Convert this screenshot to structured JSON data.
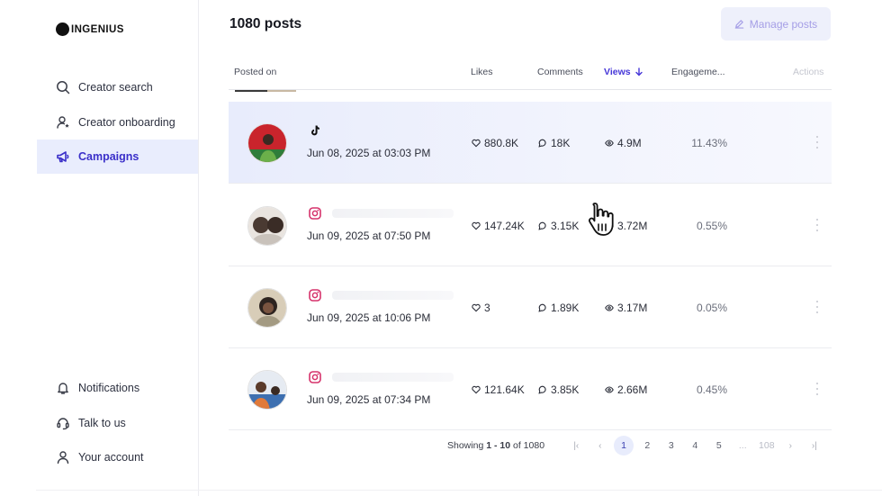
{
  "app": {
    "logo": "INGENIUS"
  },
  "sidebar": {
    "top_items": [
      {
        "label": "Creator search",
        "icon": "search-icon",
        "active": false
      },
      {
        "label": "Creator onboarding",
        "icon": "user-star-icon",
        "active": false
      },
      {
        "label": "Campaigns",
        "icon": "megaphone-icon",
        "active": true
      }
    ],
    "bottom_items": [
      {
        "label": "Notifications",
        "icon": "bell-icon"
      },
      {
        "label": "Talk to us",
        "icon": "headset-icon"
      },
      {
        "label": "Your account",
        "icon": "user-icon"
      }
    ]
  },
  "header": {
    "title": "1080 posts",
    "manage_label": "Manage posts"
  },
  "table": {
    "columns": {
      "posted_on": "Posted on",
      "likes": "Likes",
      "comments": "Comments",
      "views": "Views",
      "engagement": "Engageme...",
      "actions": "Actions"
    },
    "sort_column": "Views",
    "sort_direction": "descending",
    "rows": [
      {
        "platform": "tiktok",
        "date": "Jun 08, 2025 at 03:03 PM",
        "likes": "880.8K",
        "comments": "18K",
        "views": "4.9M",
        "engagement": "11.43%",
        "highlighted": true
      },
      {
        "platform": "instagram",
        "date": "Jun 09, 2025 at 07:50 PM",
        "likes": "147.24K",
        "comments": "3.15K",
        "views": "3.72M",
        "engagement": "0.55%",
        "highlighted": false
      },
      {
        "platform": "instagram",
        "date": "Jun 09, 2025 at 10:06 PM",
        "likes": "3",
        "comments": "1.89K",
        "views": "3.17M",
        "engagement": "0.05%",
        "highlighted": false
      },
      {
        "platform": "instagram",
        "date": "Jun 09, 2025 at 07:34 PM",
        "likes": "121.64K",
        "comments": "3.85K",
        "views": "2.66M",
        "engagement": "0.45%",
        "highlighted": false
      }
    ]
  },
  "pagination": {
    "showing_prefix": "Showing",
    "range": "1 - 10",
    "of_word": "of",
    "total": "1080",
    "pages": [
      "1",
      "2",
      "3",
      "4",
      "5",
      "...",
      "108"
    ],
    "current_page": "1"
  },
  "colors": {
    "accent": "#4637d8",
    "active_bg": "#e9edfd",
    "row_highlight": "#e8ecfc"
  }
}
